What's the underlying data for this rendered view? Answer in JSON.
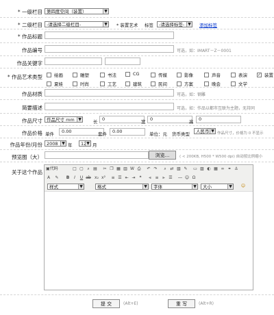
{
  "form": {
    "level1": {
      "label": "一级栏目",
      "value": "第四度空间（装置）"
    },
    "level2": {
      "label": "二级栏目",
      "value": "-请选择二级栏目-"
    },
    "art_label": "装置艺术",
    "tag": {
      "label": "标签",
      "value": "-请选择标签-",
      "add_link": "添加标签"
    },
    "title": {
      "label": "作品标题"
    },
    "code": {
      "label": "作品编号",
      "hint": "可选，如：IMART－Z－0001"
    },
    "keywords": {
      "label": "作品关键字"
    },
    "types": {
      "label": "作品艺术类型",
      "items": [
        {
          "label": "绘画",
          "checked": false
        },
        {
          "label": "雕塑",
          "checked": false
        },
        {
          "label": "书法",
          "checked": false
        },
        {
          "label": "CG",
          "checked": false
        },
        {
          "label": "传媒",
          "checked": false
        },
        {
          "label": "影像",
          "checked": false
        },
        {
          "label": "声音",
          "checked": false
        },
        {
          "label": "表演",
          "checked": false
        },
        {
          "label": "装置",
          "checked": true
        },
        {
          "label": "夏娃",
          "checked": false
        },
        {
          "label": "时尚",
          "checked": false
        },
        {
          "label": "工艺",
          "checked": false
        },
        {
          "label": "建筑",
          "checked": false
        },
        {
          "label": "民间",
          "checked": false
        },
        {
          "label": "方案",
          "checked": false
        },
        {
          "label": "晚会",
          "checked": false
        },
        {
          "label": "文学",
          "checked": false
        }
      ]
    },
    "material": {
      "label": "作品材质",
      "hint": "可选，如：钢雕"
    },
    "brief": {
      "label": "简要描述",
      "hint": "可选，如：作品以都市互联为主题，无持同"
    },
    "size": {
      "label": "作品尺寸",
      "unit": "作品尺寸 mm",
      "l_label": "长",
      "w_label": "宽",
      "h_label": "高",
      "l": "0",
      "w": "0",
      "h": "0"
    },
    "price": {
      "label": "作品价格",
      "single_label": "单件",
      "single": "0.00",
      "set_label": "套件",
      "set": "0.00",
      "unit_label": "单位：元",
      "currency_label": "货币类型",
      "currency": "人民币",
      "hint": "作品尺寸，价格为 0 不显示"
    },
    "date": {
      "label": "作品年份/月份",
      "year": "2008",
      "year_unit": "年",
      "month": "12",
      "month_unit": "月"
    },
    "preview": {
      "label": "预览图（大）",
      "browse": "浏览...",
      "hint": "( < 200KB, H500 * W500 dpi) 自动按比例缩小"
    },
    "about": {
      "label": "关于这个作品"
    },
    "editor": {
      "source": "代码",
      "style": "样式",
      "format": "格式",
      "font": "字体",
      "size": "大小"
    },
    "submit": {
      "label": "提 交",
      "hint": "(Alt+E)"
    },
    "reset": {
      "label": "重 写",
      "hint": "(Alt+R)"
    }
  }
}
